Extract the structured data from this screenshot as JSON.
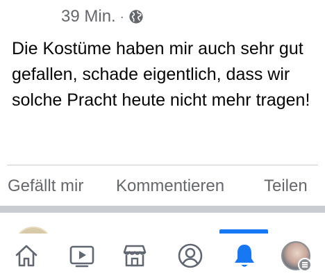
{
  "post": {
    "timestamp": "39 Min.",
    "separator": "·",
    "audience_icon": "globe-icon",
    "text": "Die Kostüme haben mir auch sehr gut gefallen, schade eigentlich, dass wir solche Pracht heute nicht mehr tragen!"
  },
  "actions": {
    "like_label": "Gefällt mir",
    "comment_label": "Kommentieren",
    "share_label": "Teilen"
  },
  "tabbar": {
    "items": [
      {
        "icon": "home-icon",
        "active": false
      },
      {
        "icon": "video-icon",
        "active": false
      },
      {
        "icon": "marketplace-icon",
        "active": false
      },
      {
        "icon": "profile-icon",
        "active": false
      },
      {
        "icon": "notifications-bell-icon",
        "active": true
      },
      {
        "icon": "menu-avatar-icon",
        "active": false
      }
    ]
  },
  "colors": {
    "accent": "#1877f2",
    "secondary_text": "#65676b",
    "divider": "#c9ccd1"
  }
}
